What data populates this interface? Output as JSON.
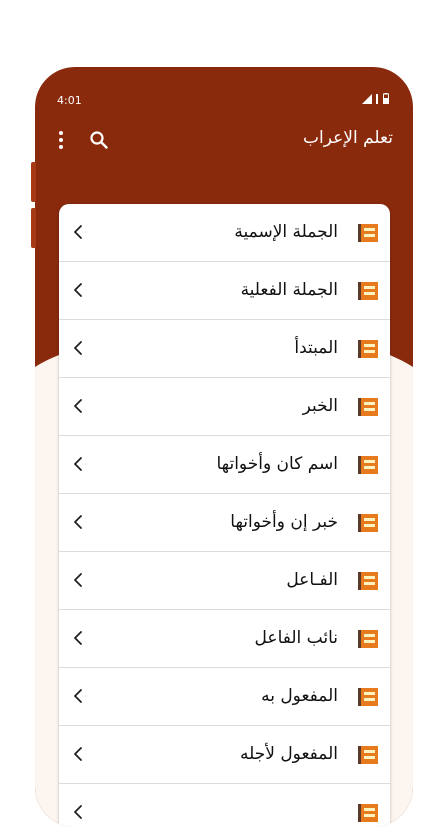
{
  "status_bar": {
    "time": "4:01"
  },
  "app_bar": {
    "title": "تعلم الإعراب"
  },
  "colors": {
    "primary": "#8a2a0d",
    "accent_book": "#e87a1e"
  },
  "list": {
    "items": [
      {
        "label": "الجملة الإسمية"
      },
      {
        "label": "الجملة الفعلية"
      },
      {
        "label": "المبتدأ"
      },
      {
        "label": "الخبر"
      },
      {
        "label": "اسم كان وأخواتها"
      },
      {
        "label": "خبر إن وأخواتها"
      },
      {
        "label": "الفـاعل"
      },
      {
        "label": "نائب الفاعل"
      },
      {
        "label": "المفعول به"
      },
      {
        "label": "المفعول لأجله"
      },
      {
        "label": ""
      }
    ]
  }
}
